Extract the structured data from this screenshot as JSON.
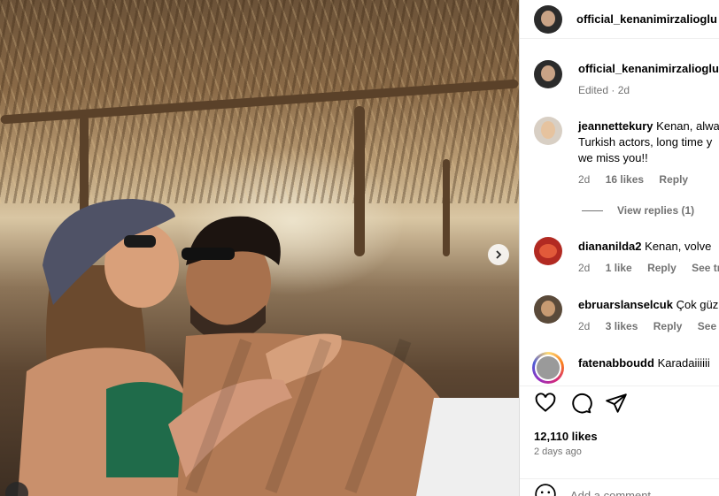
{
  "post": {
    "author": "official_kenanimirzalioglu",
    "photo_alt": "",
    "caption_author": "official_kenanimirzalioglu",
    "caption_meta": "Edited · 2d"
  },
  "comments": [
    {
      "user": "jeannettekury",
      "lines": [
        "Kenan, alwa",
        "Turkish actors, long time y",
        "we miss you!!"
      ],
      "time": "2d",
      "likes": "16 likes",
      "reply": "Reply",
      "view_replies": "View replies (1)"
    },
    {
      "user": "diananilda2",
      "lines": [
        "Kenan, volve"
      ],
      "time": "2d",
      "likes": "1 like",
      "reply": "Reply",
      "translation": "See transl"
    },
    {
      "user": "ebruarslanselcuk",
      "lines": [
        "Çok güz"
      ],
      "time": "2d",
      "likes": "3 likes",
      "reply": "Reply",
      "translation": "See trans"
    },
    {
      "user": "fatenabboudd",
      "lines": [
        "Karadaiiiiii"
      ]
    }
  ],
  "actions": {
    "likes_count": "12,110 likes",
    "posted": "2 days ago",
    "add_comment_placeholder": "Add a comment..."
  },
  "icons": {
    "like": "heart-icon",
    "comment": "comment-bubble-icon",
    "share": "paper-plane-icon",
    "next": "chevron-right-icon",
    "emoji": "smiley-icon"
  },
  "colors": {
    "meta_text": "#737373",
    "border": "#dbdbdb"
  }
}
